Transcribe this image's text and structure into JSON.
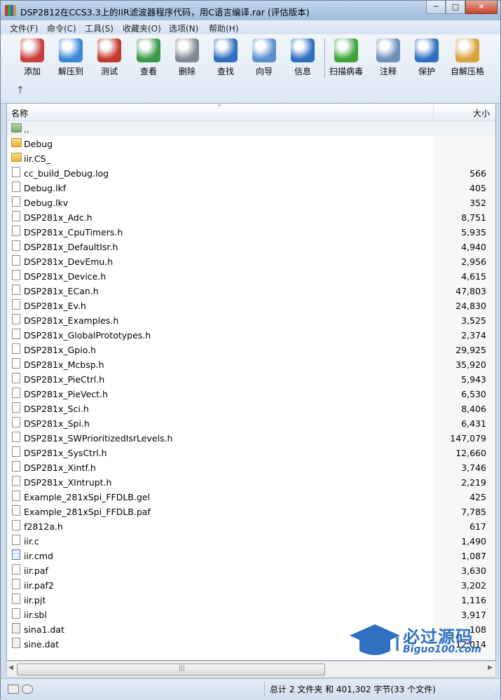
{
  "window": {
    "title": "DSP2812在CCS3.3上的IIR滤波器程序代码，用C语言编译.rar (评估版本)"
  },
  "titlebar": {
    "min": "─",
    "max": "□",
    "close": "✕"
  },
  "menu": [
    "文件(F)",
    "命令(C)",
    "工具(S)",
    "收藏夹(O)",
    "选项(N)",
    "帮助(H)"
  ],
  "toolbar": {
    "items": [
      {
        "label": "添加",
        "icon": "add-books-icon",
        "color": "#c9403a"
      },
      {
        "label": "解压到",
        "icon": "extract-folder-icon",
        "color": "#3b86d6"
      },
      {
        "label": "测试",
        "icon": "test-clipboard-icon",
        "color": "#c0392b"
      },
      {
        "label": "查看",
        "icon": "view-book-icon",
        "color": "#3a9a4a"
      },
      {
        "label": "删除",
        "icon": "delete-bin-icon",
        "color": "#7f8a96"
      },
      {
        "label": "查找",
        "icon": "find-magnifier-icon",
        "color": "#2f6fc0"
      },
      {
        "label": "向导",
        "icon": "wizard-wand-icon",
        "color": "#5a8fd0"
      },
      {
        "label": "信息",
        "icon": "info-icon",
        "color": "#2f6fc0"
      },
      {
        "label": "扫描病毒",
        "icon": "virus-scan-icon",
        "color": "#3fa33a"
      },
      {
        "label": "注释",
        "icon": "comment-icon",
        "color": "#6d8fb8"
      },
      {
        "label": "保护",
        "icon": "protect-shield-icon",
        "color": "#2f6fc0"
      },
      {
        "label": "自解压格",
        "icon": "sfx-box-icon",
        "color": "#d9a23b"
      }
    ],
    "up_arrow": "↑"
  },
  "columns": {
    "name": "名称",
    "size": "大小",
    "sort_indicator": "^"
  },
  "files": [
    {
      "name": "..",
      "size": "",
      "type": "up"
    },
    {
      "name": "Debug",
      "size": "",
      "type": "folder"
    },
    {
      "name": "iir.CS_",
      "size": "",
      "type": "folder"
    },
    {
      "name": "cc_build_Debug.log",
      "size": "566",
      "type": "file"
    },
    {
      "name": "Debug.lkf",
      "size": "405",
      "type": "file"
    },
    {
      "name": "Debug.lkv",
      "size": "352",
      "type": "file"
    },
    {
      "name": "DSP281x_Adc.h",
      "size": "8,751",
      "type": "file"
    },
    {
      "name": "DSP281x_CpuTimers.h",
      "size": "5,935",
      "type": "file"
    },
    {
      "name": "DSP281x_DefaultIsr.h",
      "size": "4,940",
      "type": "file"
    },
    {
      "name": "DSP281x_DevEmu.h",
      "size": "2,956",
      "type": "file"
    },
    {
      "name": "DSP281x_Device.h",
      "size": "4,615",
      "type": "file"
    },
    {
      "name": "DSP281x_ECan.h",
      "size": "47,803",
      "type": "file"
    },
    {
      "name": "DSP281x_Ev.h",
      "size": "24,830",
      "type": "file"
    },
    {
      "name": "DSP281x_Examples.h",
      "size": "3,525",
      "type": "file"
    },
    {
      "name": "DSP281x_GlobalPrototypes.h",
      "size": "2,374",
      "type": "file"
    },
    {
      "name": "DSP281x_Gpio.h",
      "size": "29,925",
      "type": "file"
    },
    {
      "name": "DSP281x_Mcbsp.h",
      "size": "35,920",
      "type": "file"
    },
    {
      "name": "DSP281x_PieCtrl.h",
      "size": "5,943",
      "type": "file"
    },
    {
      "name": "DSP281x_PieVect.h",
      "size": "6,530",
      "type": "file"
    },
    {
      "name": "DSP281x_Sci.h",
      "size": "8,406",
      "type": "file"
    },
    {
      "name": "DSP281x_Spi.h",
      "size": "6,431",
      "type": "file"
    },
    {
      "name": "DSP281x_SWPrioritizedIsrLevels.h",
      "size": "147,079",
      "type": "file"
    },
    {
      "name": "DSP281x_SysCtrl.h",
      "size": "12,660",
      "type": "file"
    },
    {
      "name": "DSP281x_Xintf.h",
      "size": "3,746",
      "type": "file"
    },
    {
      "name": "DSP281x_XIntrupt.h",
      "size": "2,219",
      "type": "file"
    },
    {
      "name": "Example_281xSpi_FFDLB.gel",
      "size": "425",
      "type": "file"
    },
    {
      "name": "Example_281xSpi_FFDLB.paf",
      "size": "7,785",
      "type": "file"
    },
    {
      "name": "f2812a.h",
      "size": "617",
      "type": "file"
    },
    {
      "name": "iir.c",
      "size": "1,490",
      "type": "file"
    },
    {
      "name": "iir.cmd",
      "size": "1,087",
      "type": "cmd"
    },
    {
      "name": "iir.paf",
      "size": "3,630",
      "type": "file"
    },
    {
      "name": "iir.paf2",
      "size": "3,202",
      "type": "file"
    },
    {
      "name": "iir.pjt",
      "size": "1,116",
      "type": "file"
    },
    {
      "name": "iir.sbl",
      "size": "3,917",
      "type": "file"
    },
    {
      "name": "sina1.dat",
      "size": "108",
      "type": "vcd"
    },
    {
      "name": "sine.dat",
      "size": "12,014",
      "type": "vcd"
    }
  ],
  "scrollbar": {
    "left": "◀",
    "right": "▶",
    "grip": "|||"
  },
  "status": {
    "text": "总计 2 文件夹 和 401,302 字节(33 个文件)",
    "resize_grip": "⋰"
  },
  "watermark": {
    "text": "必过源码",
    "url": "Biguo100.com"
  }
}
